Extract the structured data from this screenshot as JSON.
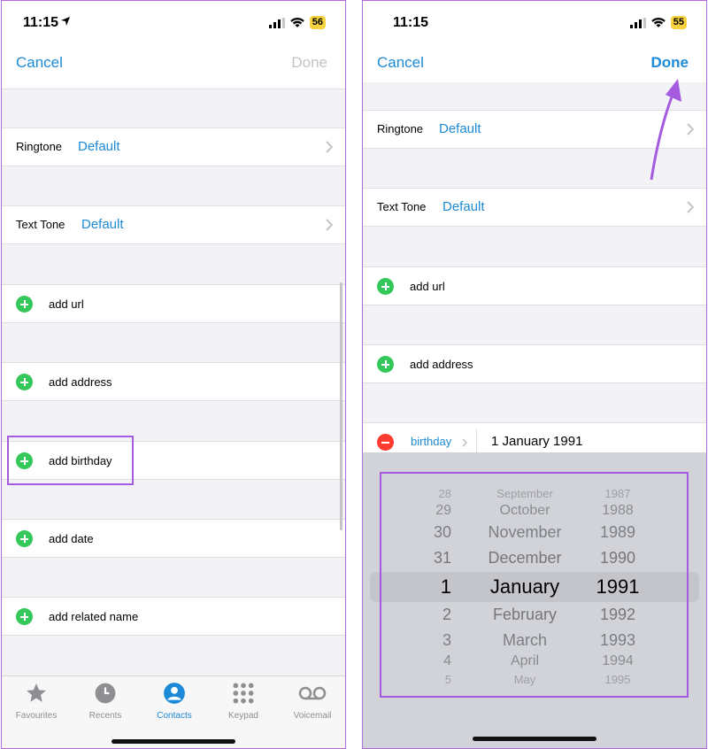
{
  "left": {
    "status": {
      "time": "11:15",
      "battery": "56"
    },
    "nav": {
      "cancel": "Cancel",
      "done": "Done",
      "done_color": "#c4c4c8"
    },
    "rows": [
      {
        "label": "Ringtone",
        "value": "Default"
      },
      {
        "label": "Text Tone",
        "value": "Default"
      }
    ],
    "add_items": [
      "add url",
      "add address",
      "add birthday",
      "add date",
      "add related name"
    ],
    "tabs": [
      {
        "label": "Favourites",
        "icon": "star-icon",
        "active": false
      },
      {
        "label": "Recents",
        "icon": "clock-icon",
        "active": false
      },
      {
        "label": "Contacts",
        "icon": "person-icon",
        "active": true
      },
      {
        "label": "Keypad",
        "icon": "keypad-icon",
        "active": false
      },
      {
        "label": "Voicemail",
        "icon": "voicemail-icon",
        "active": false
      }
    ]
  },
  "right": {
    "status": {
      "time": "11:15",
      "battery": "55"
    },
    "nav": {
      "cancel": "Cancel",
      "done": "Done",
      "done_color": "#1c8ad6"
    },
    "rows": [
      {
        "label": "Ringtone",
        "value": "Default"
      },
      {
        "label": "Text Tone",
        "value": "Default"
      }
    ],
    "add_items": [
      "add url",
      "add address"
    ],
    "birthday": {
      "label": "birthday",
      "value": "1 January 1991"
    },
    "picker": {
      "days": [
        "28",
        "29",
        "30",
        "31",
        "1",
        "2",
        "3",
        "4",
        "5"
      ],
      "months": [
        "September",
        "October",
        "November",
        "December",
        "January",
        "February",
        "March",
        "April",
        "May"
      ],
      "years": [
        "1987",
        "1988",
        "1989",
        "1990",
        "1991",
        "1992",
        "1993",
        "1994",
        "1995"
      ],
      "selected_index": 4
    }
  },
  "colors": {
    "accent": "#1c8ad6",
    "highlight": "#a45be0",
    "add_green": "#34c759",
    "remove_red": "#ff3b30"
  }
}
